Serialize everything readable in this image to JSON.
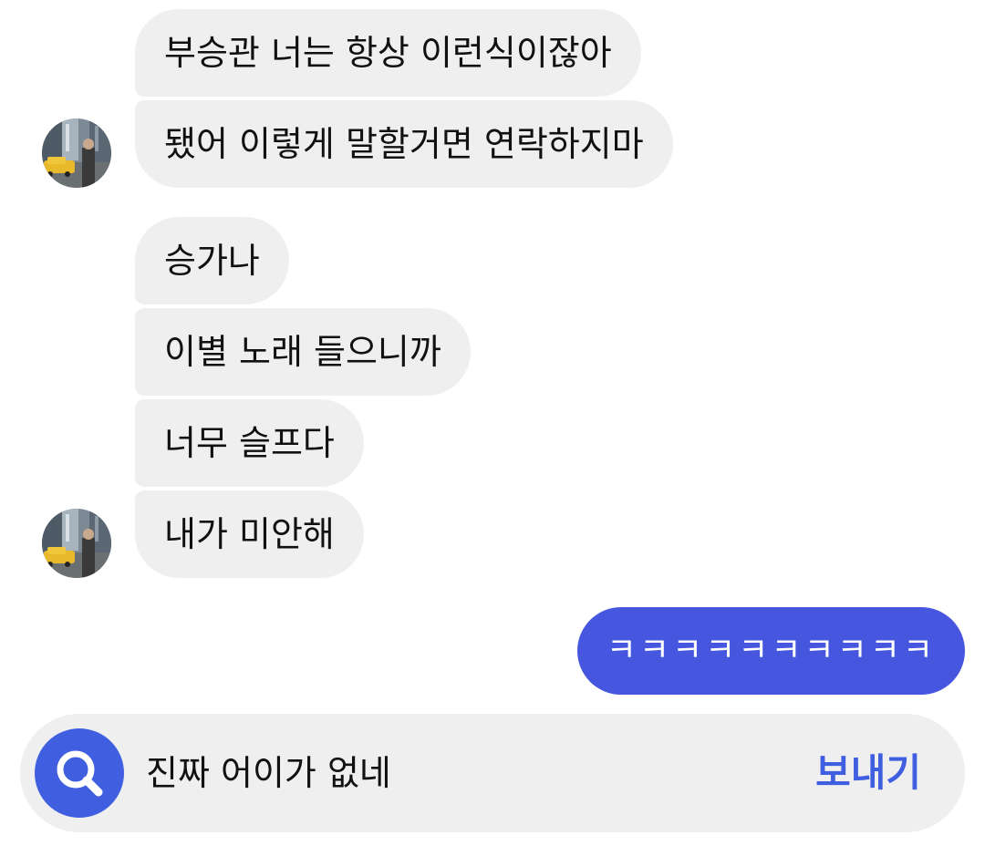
{
  "conversation": {
    "received_group_1": [
      "부승관 너는 항상 이런식이잖아",
      "됐어 이렇게 말할거면 연락하지마"
    ],
    "received_group_2": [
      "승가나",
      "이별 노래 들으니까",
      "너무 슬프다",
      "내가 미안해"
    ],
    "sent": [
      "ㅋㅋㅋㅋㅋㅋㅋㅋㅋㅋ"
    ]
  },
  "composer": {
    "input_value": "진짜 어이가 없네",
    "send_label": "보내기",
    "search_icon": "search-icon"
  },
  "colors": {
    "received_bubble": "#efefef",
    "sent_bubble": "#4656de",
    "accent": "#3f5fe0",
    "composer_background": "#efefef"
  }
}
